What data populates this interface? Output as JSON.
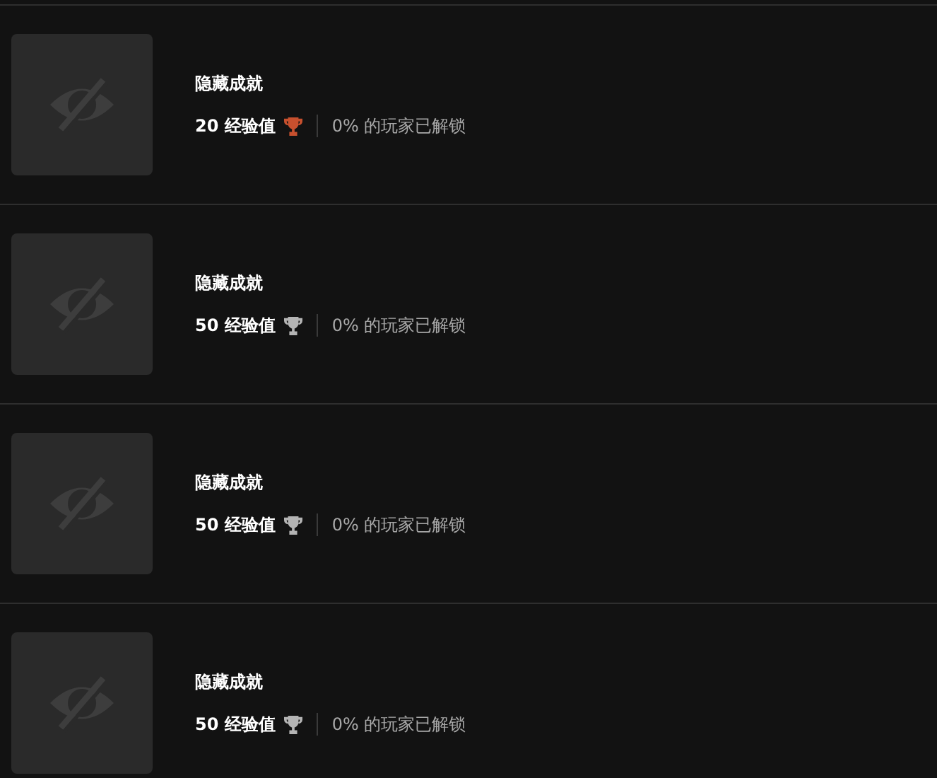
{
  "achievements": [
    {
      "title": "隐藏成就",
      "xp": "20 经验值",
      "color": "#c7502e",
      "unlock_rate": "0% 的玩家已解锁"
    },
    {
      "title": "隐藏成就",
      "xp": "50 经验值",
      "color": "#b4b4b4",
      "unlock_rate": "0% 的玩家已解锁"
    },
    {
      "title": "隐藏成就",
      "xp": "50 经验值",
      "color": "#b4b4b4",
      "unlock_rate": "0% 的玩家已解锁"
    },
    {
      "title": "隐藏成就",
      "xp": "50 经验值",
      "color": "#b4b4b4",
      "unlock_rate": "0% 的玩家已解锁"
    }
  ]
}
